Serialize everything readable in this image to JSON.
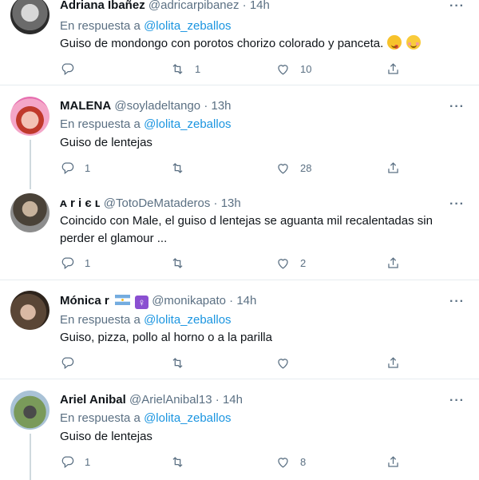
{
  "colors": {
    "accent": "#1b95e0",
    "muted": "#5b7083",
    "divider": "#e6ecf0"
  },
  "tweets": [
    {
      "name": "Adriana Ibañez",
      "handle": "@adricarpibanez",
      "sep": "·",
      "time": "14h",
      "reply_prefix": "En respuesta a",
      "reply_to": "@lolita_zeballos",
      "text": "Guiso de mondongo con porotos chorizo colorado y panceta.",
      "emojis": [
        "yum-face-emoji",
        "relieved-face-emoji"
      ],
      "replies": "",
      "retweets": "1",
      "likes": "10"
    },
    {
      "name": "MALENA",
      "handle": "@soyladeltango",
      "sep": "·",
      "time": "13h",
      "reply_prefix": "En respuesta a",
      "reply_to": "@lolita_zeballos",
      "text": "Guiso de lentejas",
      "replies": "1",
      "retweets": "",
      "likes": "28"
    },
    {
      "name": "ᴀ r i є ʟ",
      "handle": "@TotoDeMataderos",
      "sep": "·",
      "time": "13h",
      "text": "Coincido con Male, el guiso d lentejas se aguanta mil recalentadas sin perder el glamour ...",
      "replies": "1",
      "retweets": "",
      "likes": "2"
    },
    {
      "name": "Mónica r",
      "name_badges": [
        "argentina-flag-icon",
        "female-sign-icon"
      ],
      "handle": "@monikapato",
      "sep": "·",
      "time": "14h",
      "reply_prefix": "En respuesta a",
      "reply_to": "@lolita_zeballos",
      "text": "Guiso, pizza, pollo al horno o a la parilla",
      "replies": "",
      "retweets": "",
      "likes": ""
    },
    {
      "name": "Ariel Anibal",
      "handle": "@ArielAnibal13",
      "sep": "·",
      "time": "14h",
      "reply_prefix": "En respuesta a",
      "reply_to": "@lolita_zeballos",
      "text": "Guiso de lentejas",
      "replies": "1",
      "retweets": "",
      "likes": "8"
    }
  ],
  "icons": {
    "reply": "reply-icon",
    "retweet": "retweet-icon",
    "like": "heart-icon",
    "share": "share-icon",
    "more": "more-options-icon"
  },
  "more_glyph": "···"
}
